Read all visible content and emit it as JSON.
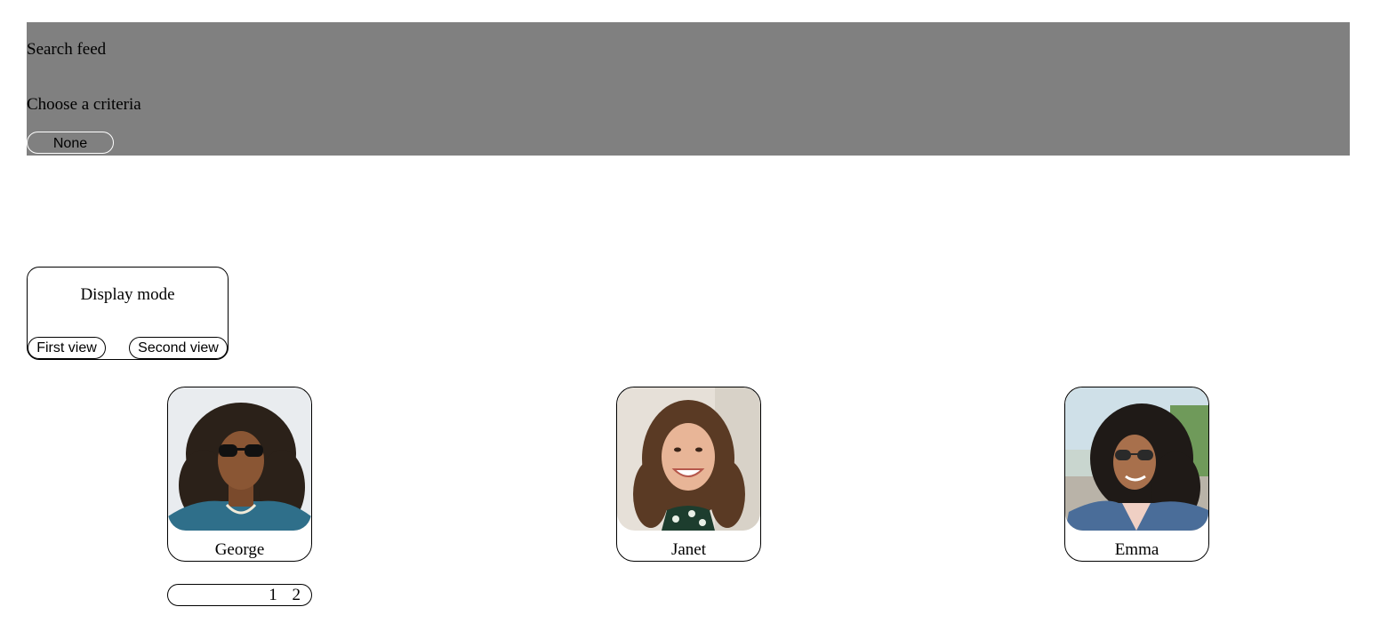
{
  "search": {
    "title": "Search feed",
    "criteria_label": "Choose a criteria",
    "criteria_selected": "None"
  },
  "display_mode": {
    "title": "Display mode",
    "first_view_label": "First view",
    "second_view_label": "Second view"
  },
  "profiles": [
    {
      "name": "George",
      "photo": "man-with-sunglasses-portrait"
    },
    {
      "name": "Janet",
      "photo": "smiling-woman-portrait"
    },
    {
      "name": "Emma",
      "photo": "woman-with-sunglasses-portrait"
    }
  ],
  "pagination": {
    "pages": [
      "1",
      "2"
    ]
  },
  "colors": {
    "search_panel_bg": "#808080",
    "page_bg": "#ffffff",
    "border": "#000000"
  }
}
